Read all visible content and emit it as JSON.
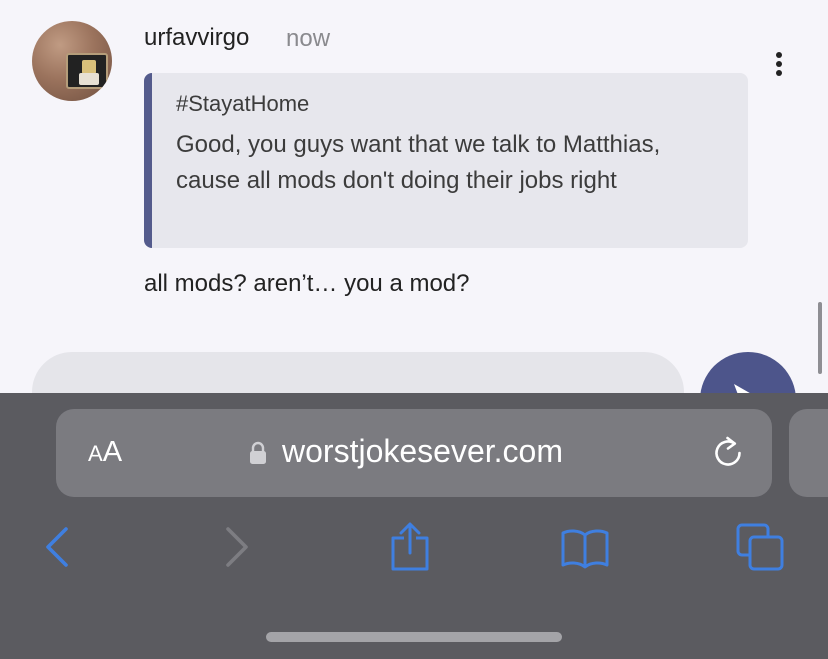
{
  "post": {
    "username": "urfavvirgo",
    "timestamp": "now",
    "quote": {
      "tag": "#StayatHome",
      "text": "Good, you guys want that we talk to Matthias, cause all mods don't doing their jobs right"
    },
    "reply": "all mods? aren’t… you a mod?"
  },
  "browser": {
    "text_size_small": "A",
    "text_size_big": "A",
    "url": "worstjokesever.com"
  },
  "colors": {
    "accent": "#4d558b",
    "toolbar": "#5b5b60",
    "link_blue": "#3f7fe0"
  },
  "icons": {
    "more": "kebab-icon",
    "send": "send-icon",
    "secure": "lock-icon",
    "reload": "reload-icon",
    "back": "chevron-left-icon",
    "forward": "chevron-right-icon",
    "share": "share-icon",
    "bookmarks": "book-icon",
    "tabs": "tabs-icon"
  }
}
